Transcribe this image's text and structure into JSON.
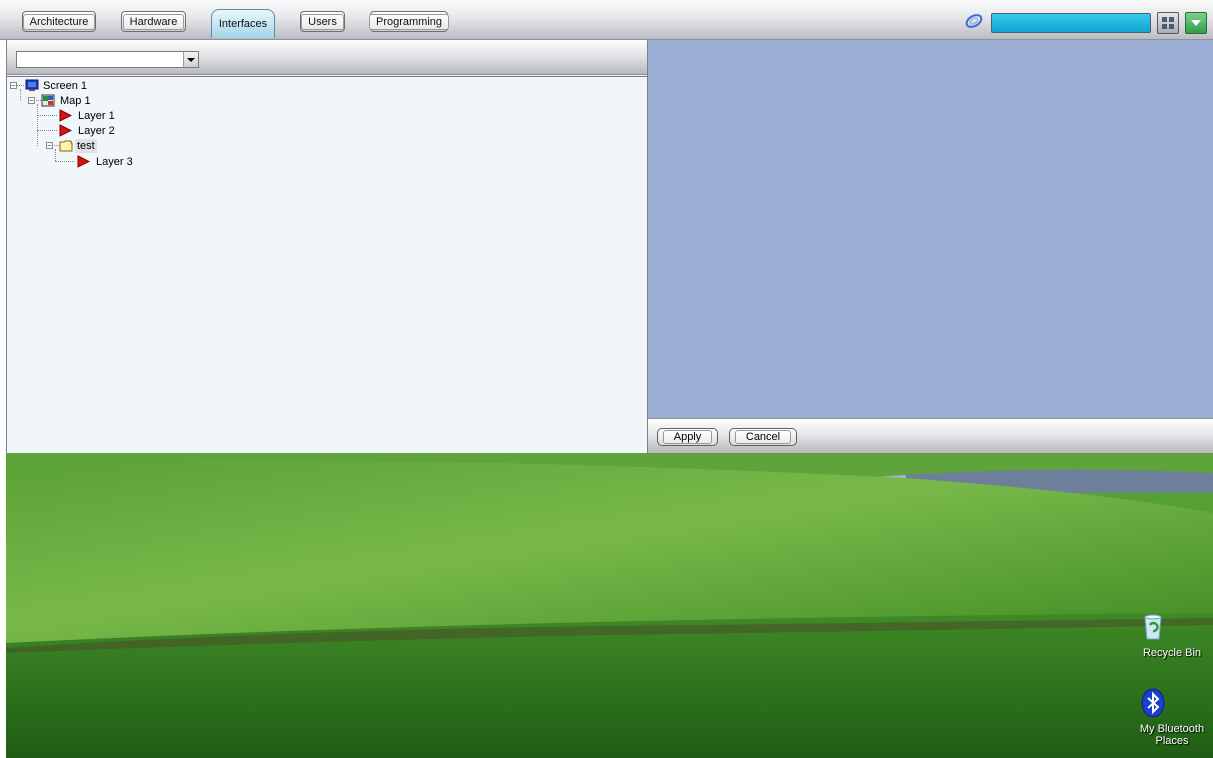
{
  "toolbar": {
    "tabs": [
      "Architecture",
      "Hardware",
      "Interfaces",
      "Users",
      "Programming"
    ],
    "active_tab": "Interfaces",
    "search_value": ""
  },
  "left_pane": {
    "combo_value": "",
    "tree": [
      {
        "label": "Screen 1",
        "icon": "monitor-icon",
        "expanded": true
      },
      {
        "label": "Map 1",
        "icon": "map-icon",
        "expanded": true
      },
      {
        "label": "Layer 1",
        "icon": "red-flag-icon"
      },
      {
        "label": "Layer 2",
        "icon": "red-flag-icon"
      },
      {
        "label": "test",
        "icon": "folder-icon",
        "expanded": true,
        "selected": true
      },
      {
        "label": "Layer 3",
        "icon": "red-flag-icon"
      }
    ]
  },
  "right_pane": {
    "apply_label": "Apply",
    "cancel_label": "Cancel"
  },
  "desktop": {
    "icons": [
      {
        "label": "Recycle Bin",
        "icon": "recycle-bin-icon"
      },
      {
        "label": "My Bluetooth Places",
        "icon": "bluetooth-icon"
      }
    ]
  },
  "colors": {
    "right_pane_bg": "#9daed4",
    "search_bg": "#1bb5de",
    "tree_bg": "#f1f6fb"
  }
}
